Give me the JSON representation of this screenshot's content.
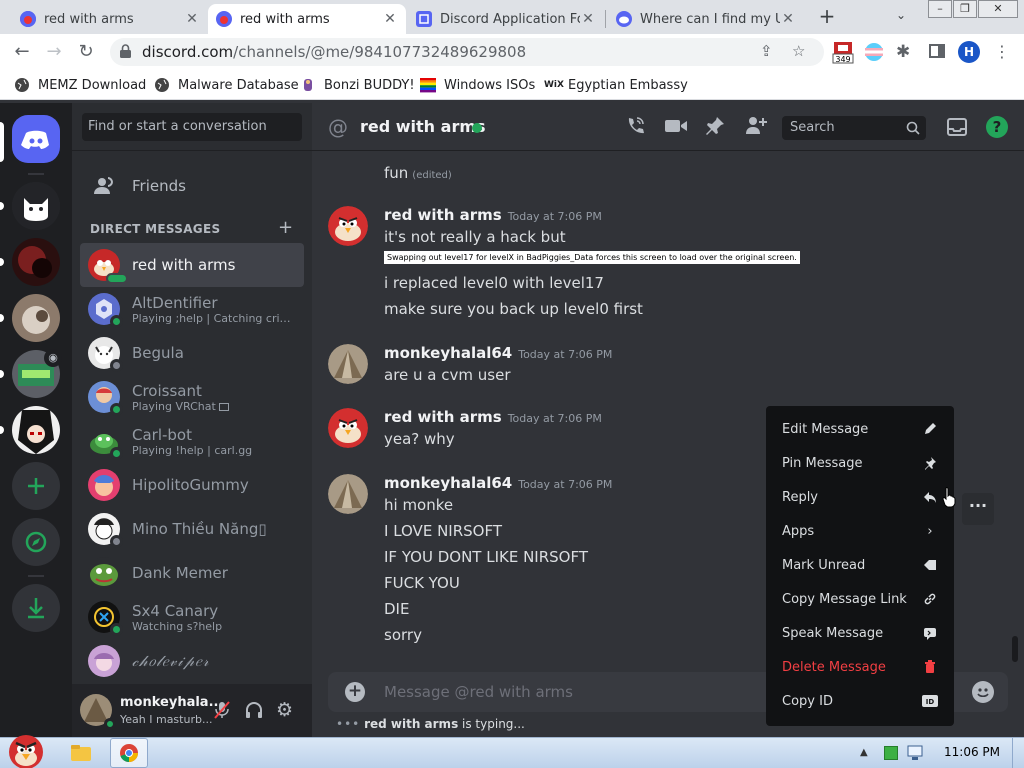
{
  "browser": {
    "tabs": [
      {
        "title": "red with arms"
      },
      {
        "title": "red with arms"
      },
      {
        "title": "Discord Application Fo"
      },
      {
        "title": "Where can I find my Us"
      }
    ],
    "url_domain": "discord.com",
    "url_path": "/channels/@me/984107732489629808",
    "extension_badge": "349",
    "profile_initial": "H",
    "bookmarks": [
      "MEMZ Download",
      "Malware Database",
      "Bonzi BUDDY!",
      "Windows ISOs",
      "Egyptian Embassy"
    ]
  },
  "sidebar": {
    "search_placeholder": "Find or start a conversation",
    "friends_label": "Friends",
    "dm_header": "DIRECT MESSAGES",
    "dms": [
      {
        "name": "red with arms",
        "sub": ""
      },
      {
        "name": "AltDentifier",
        "sub": "Playing ;help | Catching crimin..."
      },
      {
        "name": "Begula",
        "sub": ""
      },
      {
        "name": "Croissant",
        "sub": "Playing VRChat"
      },
      {
        "name": "Carl-bot",
        "sub": "Playing !help | carl.gg"
      },
      {
        "name": "HipolitoGummy",
        "sub": ""
      },
      {
        "name": "Mino Thiều Năng▯",
        "sub": ""
      },
      {
        "name": "Dank Memer",
        "sub": ""
      },
      {
        "name": "Sx4 Canary",
        "sub": "Watching s?help"
      },
      {
        "name": "𝒸𝒽𝑜𝓁𝑒𝓋𝒾𝓅𝑒𝓇",
        "sub": ""
      }
    ],
    "user": {
      "name": "monkeyhala...",
      "status": "Yeah I masturb..."
    }
  },
  "chat": {
    "channel_name": "red with arms",
    "search_placeholder": "Search",
    "cut_top_text": "fun",
    "edited_label": "(edited)",
    "groups": [
      {
        "author": "red with arms",
        "time": "Today at 7:06 PM",
        "lines": [
          "it's not really a hack but"
        ],
        "image_caption": "Swapping out level17 for levelX in BadPiggies_Data forces this screen to load over the original screen.",
        "after": [
          "i replaced level0 with level17",
          "make sure you back up level0 first"
        ]
      },
      {
        "author": "monkeyhalal64",
        "time": "Today at 7:06 PM",
        "lines": [
          "are u a cvm user"
        ]
      },
      {
        "author": "red with arms",
        "time": "Today at 7:06 PM",
        "lines": [
          "yea? why"
        ]
      },
      {
        "author": "monkeyhalal64",
        "time": "Today at 7:06 PM",
        "lines": [
          "hi monke",
          "I LOVE NIRSOFT",
          "IF YOU DONT LIKE NIRSOFT",
          "FUCK YOU",
          "DIE",
          "sorry"
        ]
      }
    ],
    "composer_placeholder": "Message @red with arms",
    "typing_user": "red with arms",
    "typing_suffix": " is typing..."
  },
  "context_menu": {
    "items": [
      {
        "label": "Edit Message",
        "icon": "pencil-icon"
      },
      {
        "label": "Pin Message",
        "icon": "pin-icon"
      },
      {
        "label": "Reply",
        "icon": "reply-icon"
      },
      {
        "label": "Apps",
        "icon": "chevron-right-icon"
      },
      {
        "label": "Mark Unread",
        "icon": "mark-unread-icon"
      },
      {
        "label": "Copy Message Link",
        "icon": "link-icon"
      },
      {
        "label": "Speak Message",
        "icon": "speak-icon"
      },
      {
        "label": "Delete Message",
        "icon": "trash-icon",
        "danger": true
      },
      {
        "label": "Copy ID",
        "icon": "id-icon"
      }
    ]
  },
  "taskbar": {
    "time": "11:06 PM"
  },
  "colors": {
    "accent": "#5865f2",
    "online": "#23a55a",
    "danger": "#f23f43"
  }
}
